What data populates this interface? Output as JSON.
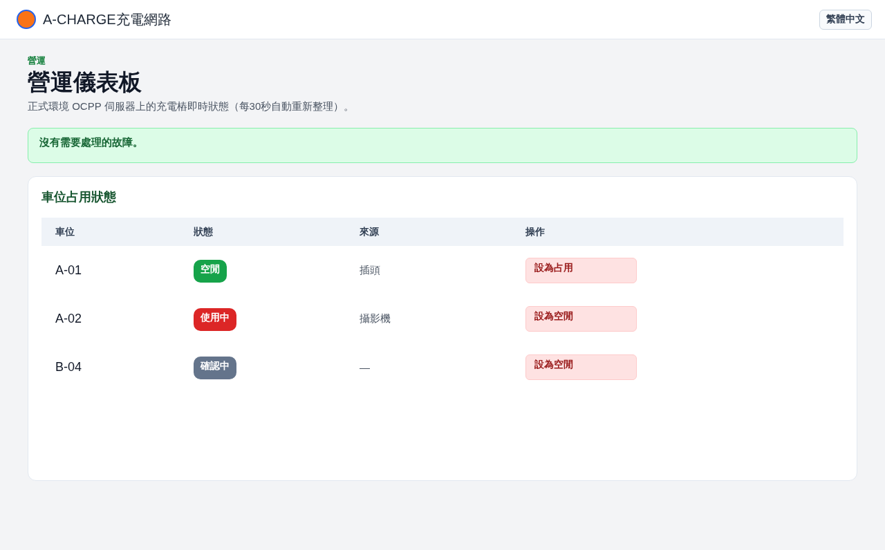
{
  "header": {
    "brand": "A-CHARGE充電網路",
    "language_button": "繁體中文"
  },
  "page": {
    "breadcrumb": "營運",
    "title": "營運儀表板",
    "subtitle": "正式環境 OCPP 伺服器上的充電樁即時狀態（每30秒自動重新整理）。"
  },
  "alert": {
    "kind": "success",
    "text": "沒有需要處理的故障。"
  },
  "occupancy_card": {
    "title": "車位占用狀態",
    "table": {
      "columns": [
        "車位",
        "狀態",
        "來源",
        "操作"
      ],
      "rows": [
        {
          "slot": "A-01",
          "status": {
            "label": "空閒",
            "color": "#16a34a"
          },
          "source": "插頭",
          "action": "設為占用"
        },
        {
          "slot": "A-02",
          "status": {
            "label": "使用中",
            "color": "#dc2626"
          },
          "source": "攝影機",
          "action": "設為空閒"
        },
        {
          "slot": "B-04",
          "status": {
            "label": "確認中",
            "color": "#64748b"
          },
          "source": "—",
          "action": "設為空閒"
        }
      ]
    }
  }
}
